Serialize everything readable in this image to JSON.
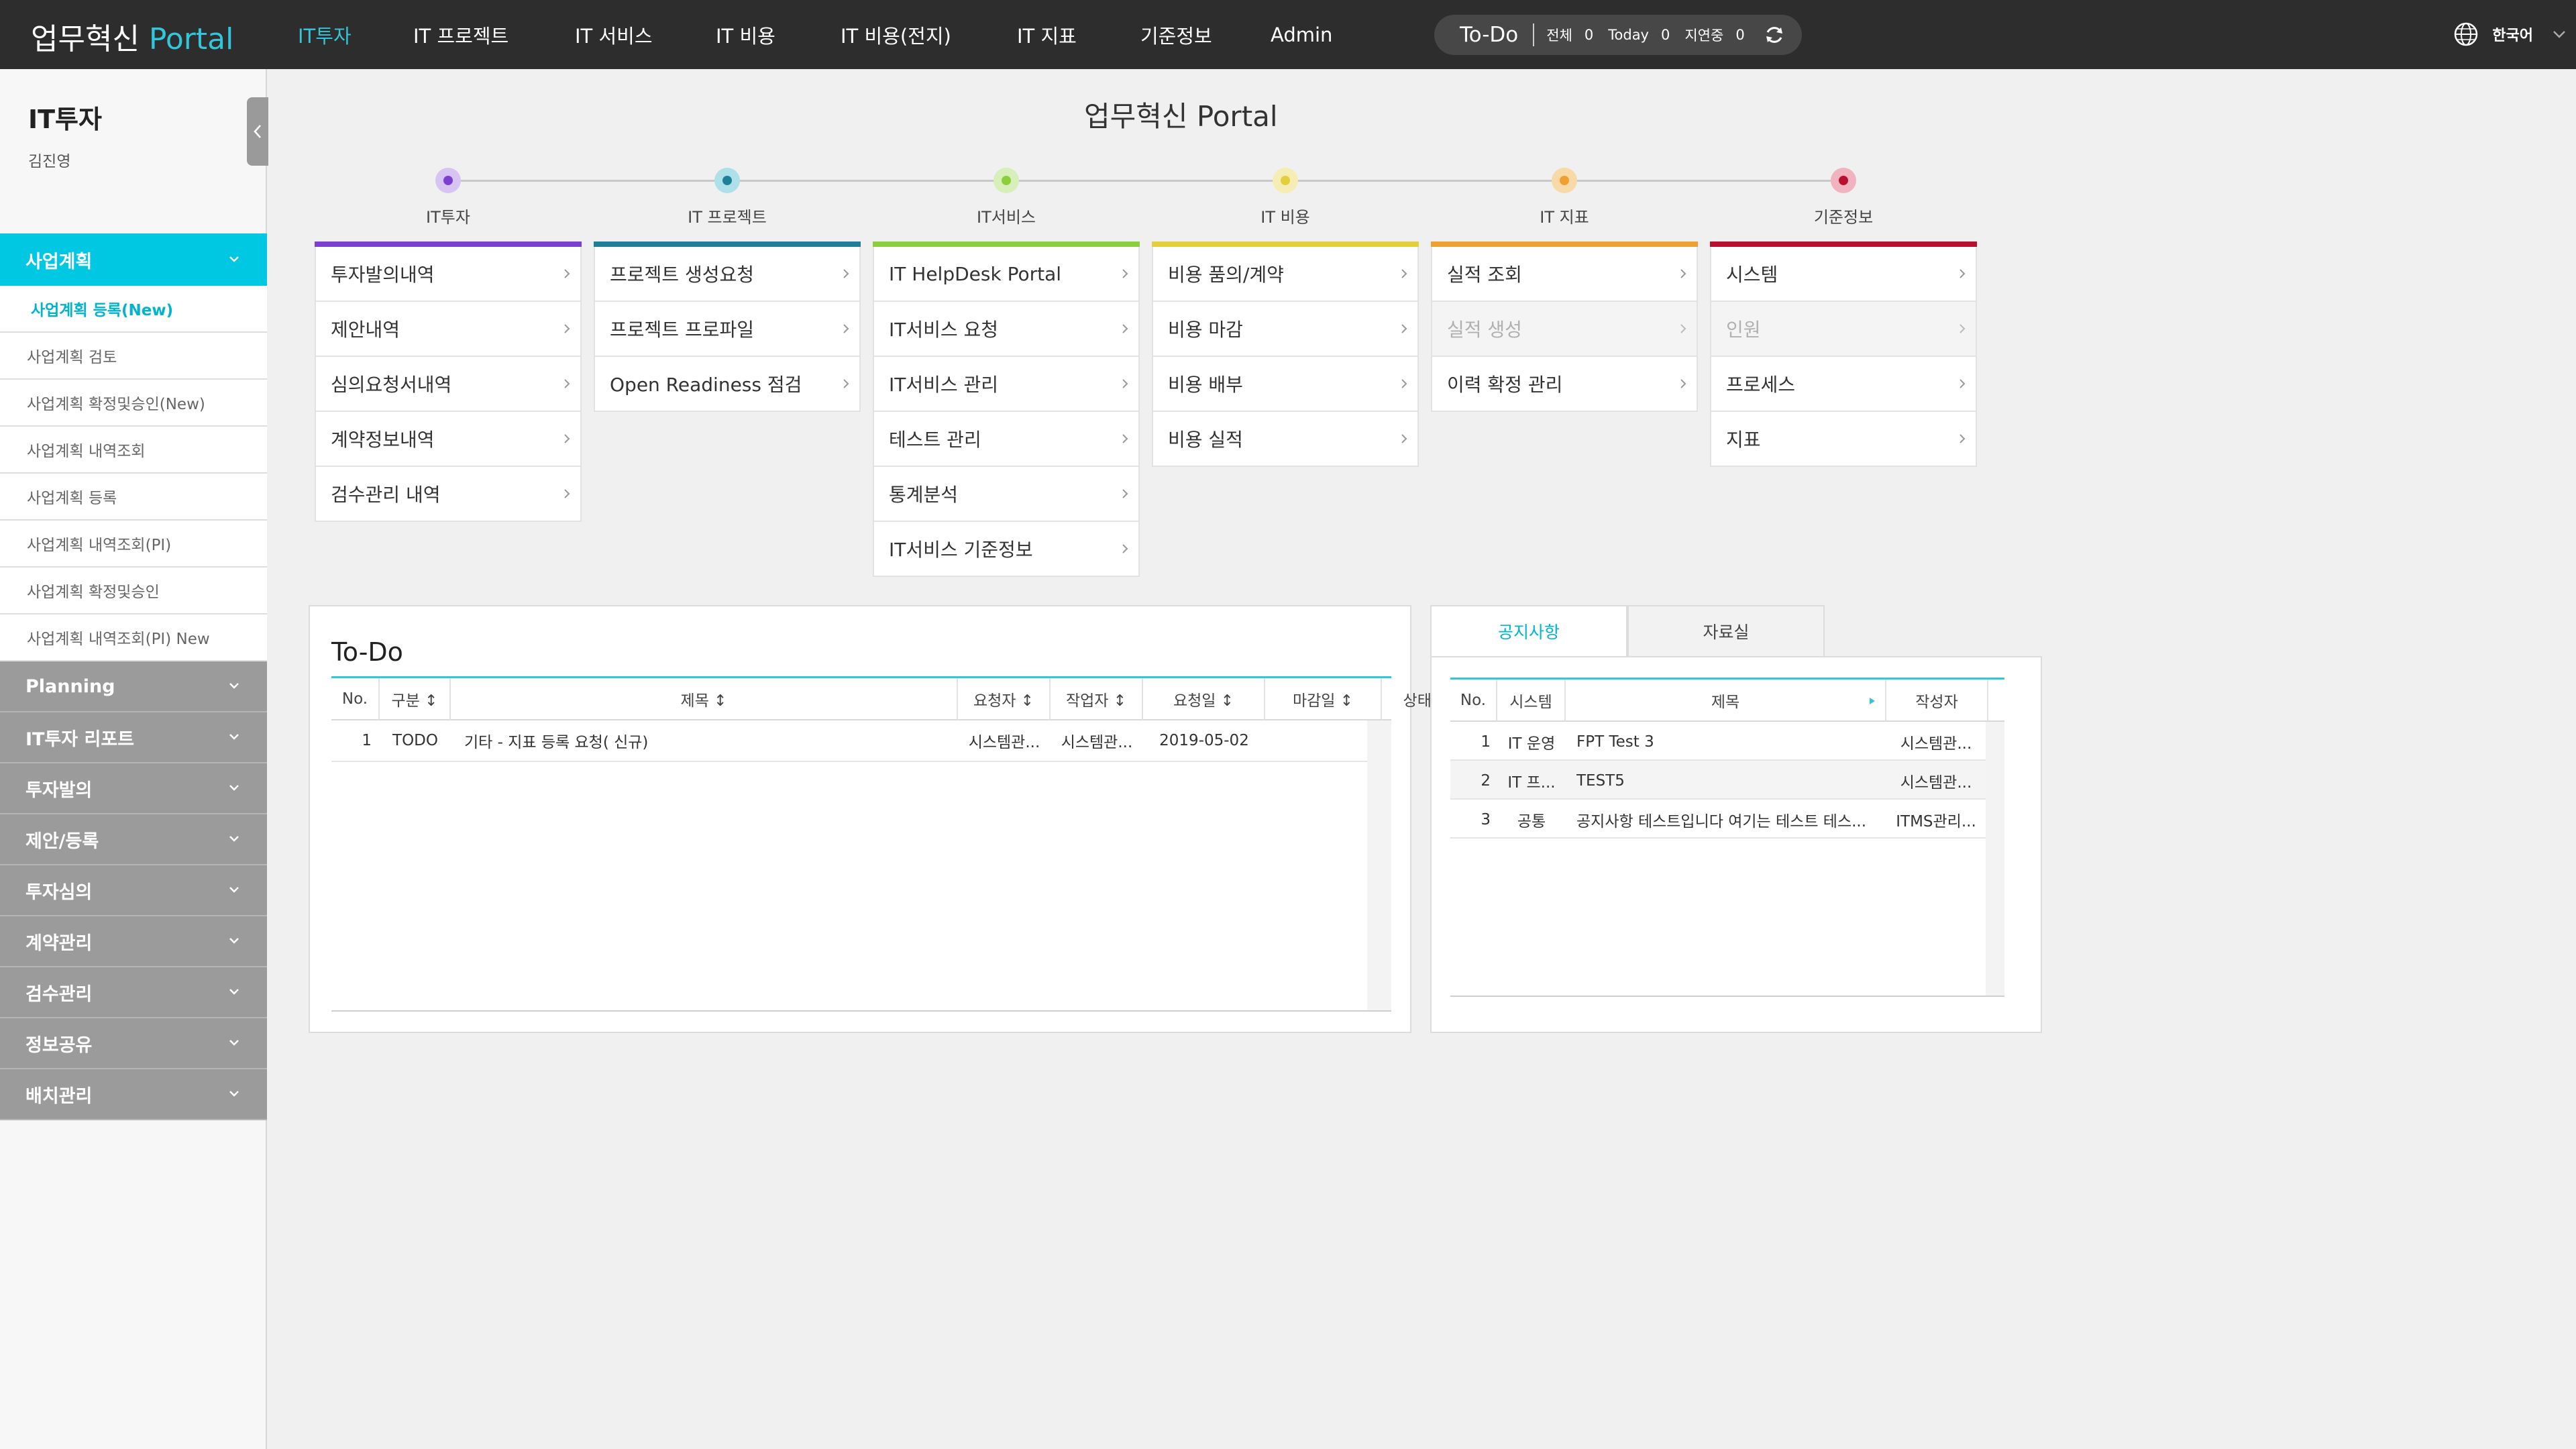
{
  "header": {
    "brand_main": "업무혁신",
    "brand_accent": "Portal",
    "nav": [
      {
        "label": "IT투자",
        "active": true
      },
      {
        "label": "IT 프로젝트"
      },
      {
        "label": "IT 서비스"
      },
      {
        "label": "IT 비용"
      },
      {
        "label": "IT 비용(전지)"
      },
      {
        "label": "IT 지표"
      },
      {
        "label": "기준정보"
      },
      {
        "label": "Admin"
      }
    ],
    "todo": {
      "title": "To-Do",
      "total_label": "전체",
      "total": "0",
      "today_label": "Today",
      "today": "0",
      "delayed_label": "지연중",
      "delayed": "0"
    },
    "language": "한국어"
  },
  "sidebar": {
    "title": "IT투자",
    "user": "김진영",
    "active_menu": "사업계획",
    "sub_items": [
      "사업계획 등록(New)",
      "사업계획 검토",
      "사업계획 확정및승인(New)",
      "사업계획 내역조회",
      "사업계획 등록",
      "사업계획 내역조회(PI)",
      "사업계획 확정및승인",
      "사업계획 내역조회(PI) New"
    ],
    "menus": [
      "Planning",
      "IT투자 리포트",
      "투자발의",
      "제안/등록",
      "투자심의",
      "계약관리",
      "검수관리",
      "정보공유",
      "배치관리"
    ]
  },
  "main": {
    "title": "업무혁신 Portal",
    "stages": [
      {
        "label": "IT투자",
        "color": "#7b3fd1",
        "items": [
          "투자발의내역",
          "제안내역",
          "심의요청서내역",
          "계약정보내역",
          "검수관리 내역"
        ]
      },
      {
        "label": "IT 프로젝트",
        "color": "#1f7f98",
        "items": [
          "프로젝트 생성요청",
          "프로젝트 프로파일",
          "Open Readiness 점검"
        ]
      },
      {
        "label": "IT서비스",
        "color": "#8ccf3c",
        "items": [
          "IT HelpDesk Portal",
          "IT서비스 요청",
          "IT서비스 관리",
          "테스트 관리",
          "통계분석",
          "IT서비스 기준정보"
        ]
      },
      {
        "label": "IT 비용",
        "color": "#e2cf3a",
        "items": [
          "비용 품의/계약",
          "비용 마감",
          "비용 배부",
          "비용 실적"
        ]
      },
      {
        "label": "IT 지표",
        "color": "#f0a030",
        "items": [
          "실적 조회",
          "실적 생성",
          "이력 확정 관리"
        ]
      },
      {
        "label": "기준정보",
        "color": "#b8102e",
        "items": [
          "시스템",
          "인원",
          "프로세스",
          "지표"
        ]
      }
    ]
  },
  "todo_panel": {
    "title": "To-Do",
    "columns": [
      "No.",
      "구분 ↕",
      "제목 ↕",
      "요청자 ↕",
      "작업자 ↕",
      "요청일 ↕",
      "마감일 ↕",
      "상태 ↕"
    ],
    "rows": [
      {
        "no": "1",
        "type": "TODO",
        "title": "기타 - 지표 등록 요청( 신규)",
        "requester": "시스템관...",
        "worker": "시스템관...",
        "request_date": "2019-05-02",
        "due_date": "",
        "status": ""
      }
    ]
  },
  "notice": {
    "tabs": [
      "공지사항",
      "자료실"
    ],
    "columns": [
      "No.",
      "시스템",
      "제목",
      "작성자"
    ],
    "rows": [
      {
        "no": "1",
        "system": "IT 운영",
        "title": "FPT Test 3",
        "author": "시스템관..."
      },
      {
        "no": "2",
        "system": "IT 프...",
        "title": "TEST5",
        "author": "시스템관..."
      },
      {
        "no": "3",
        "system": "공통",
        "title": "공지사항 테스트입니다 여기는 테스트 테스...",
        "author": "ITMS관리..."
      }
    ]
  },
  "colors": {
    "accent": "#33c5d8",
    "topbar": "#2d2d2d",
    "sidebar_active": "#00c7e2",
    "sidebar_menu": "#9b9b9b"
  }
}
